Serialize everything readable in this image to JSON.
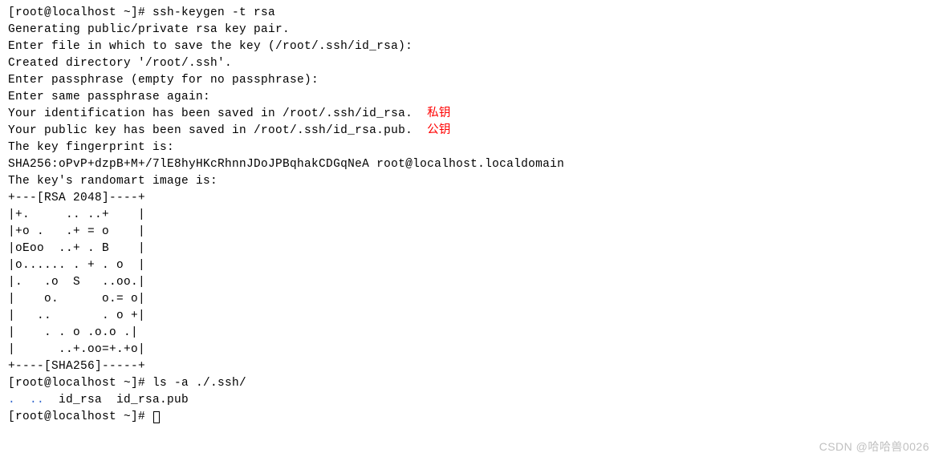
{
  "prompt1": "[root@localhost ~]# ",
  "cmd1": "ssh-keygen -t rsa",
  "l1": "Generating public/private rsa key pair.",
  "l2": "Enter file in which to save the key (/root/.ssh/id_rsa):",
  "l3": "Created directory '/root/.ssh'.",
  "l4": "Enter passphrase (empty for no passphrase):",
  "l5": "Enter same passphrase again:",
  "l6a": "Your identification has been saved in /root/.ssh/id_rsa.  ",
  "l6b": "私钥",
  "l7a": "Your public key has been saved in /root/.ssh/id_rsa.pub.  ",
  "l7b": "公钥",
  "l8": "The key fingerprint is:",
  "l9": "SHA256:oPvP+dzpB+M+/7lE8hyHKcRhnnJDoJPBqhakCDGqNeA root@localhost.localdomain",
  "l10": "The key's randomart image is:",
  "art0": "+---[RSA 2048]----+",
  "art1": "|+.     .. ..+    |",
  "art2": "|+o .   .+ = o    |",
  "art3": "|oEoo  ..+ . B    |",
  "art4": "|o...... . + . o  |",
  "art5": "|.   .o  S   ..oo.|",
  "art6": "|    o.      o.= o|",
  "art7": "|   ..       . o +|",
  "art8": "|    . . o .o.o .|",
  "art9": "|      ..+.oo=+.+o|",
  "art10": "+----[SHA256]-----+",
  "prompt2": "[root@localhost ~]# ",
  "cmd2": "ls -a ./.ssh/",
  "ls_dots": ".  ..",
  "ls_files": "  id_rsa  id_rsa.pub",
  "prompt3": "[root@localhost ~]# ",
  "watermark": "CSDN @哈哈兽0026"
}
